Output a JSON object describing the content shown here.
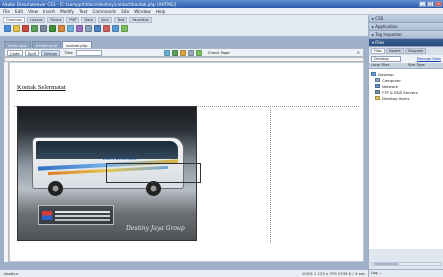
{
  "window": {
    "title": "Adobe Dreamweaver CS3 - [C:\\xampp\\htdocs\\destiny\\contact\\kontak.php (XHTML)]"
  },
  "menu": [
    "File",
    "Edit",
    "View",
    "Insert",
    "Modify",
    "Text",
    "Commands",
    "Site",
    "Window",
    "Help"
  ],
  "insert_bar": {
    "tabs": [
      "Common",
      "Layout",
      "Forms",
      "PHP",
      "Data",
      "Spry",
      "Text",
      "Favorites"
    ],
    "active_tab": "Common",
    "icons": [
      "hyperlink-icon",
      "email-link-icon",
      "named-anchor-icon",
      "table-icon",
      "div-icon",
      "images-icon",
      "media-icon",
      "date-icon",
      "server-include-icon",
      "comment-icon",
      "head-icon",
      "script-icon",
      "templates-icon",
      "tag-chooser-icon"
    ]
  },
  "document": {
    "tabs": [
      "index.php",
      "header.php",
      "kontak.php"
    ],
    "active_tab": "kontak.php",
    "views": {
      "code": "Code",
      "split": "Split",
      "design": "Design"
    },
    "active_view": "Design",
    "title_label": "Title:",
    "title_value": "",
    "check_page": "Check Page",
    "heading": "Kontak Selermatat",
    "watermark": "Destiny Jaya Group",
    "bus_logo": "Bus Pariwisata"
  },
  "status_bar": {
    "tag": "<body>",
    "info": "100%   1 125 x 379   2539 K / 4 sec"
  },
  "right_panel": {
    "collapsed_panels": [
      "CSS",
      "Application",
      "Tag Inspector"
    ],
    "files_panel_title": "Files",
    "files_tabs": [
      "Files",
      "Assets",
      "Snippets"
    ],
    "site_select": "Desktop",
    "manage_sites": "Manage Sites",
    "columns": [
      "Local Files",
      "Size Type"
    ],
    "tree": [
      "Desktop",
      "Computer",
      "Network",
      "FTP & RDS Servers",
      "Desktop Items"
    ],
    "status": "Log..."
  },
  "colors": {
    "title_bar": "#2c5cab",
    "panel_header": "#2c4c7c",
    "link": "#1a48b3"
  }
}
